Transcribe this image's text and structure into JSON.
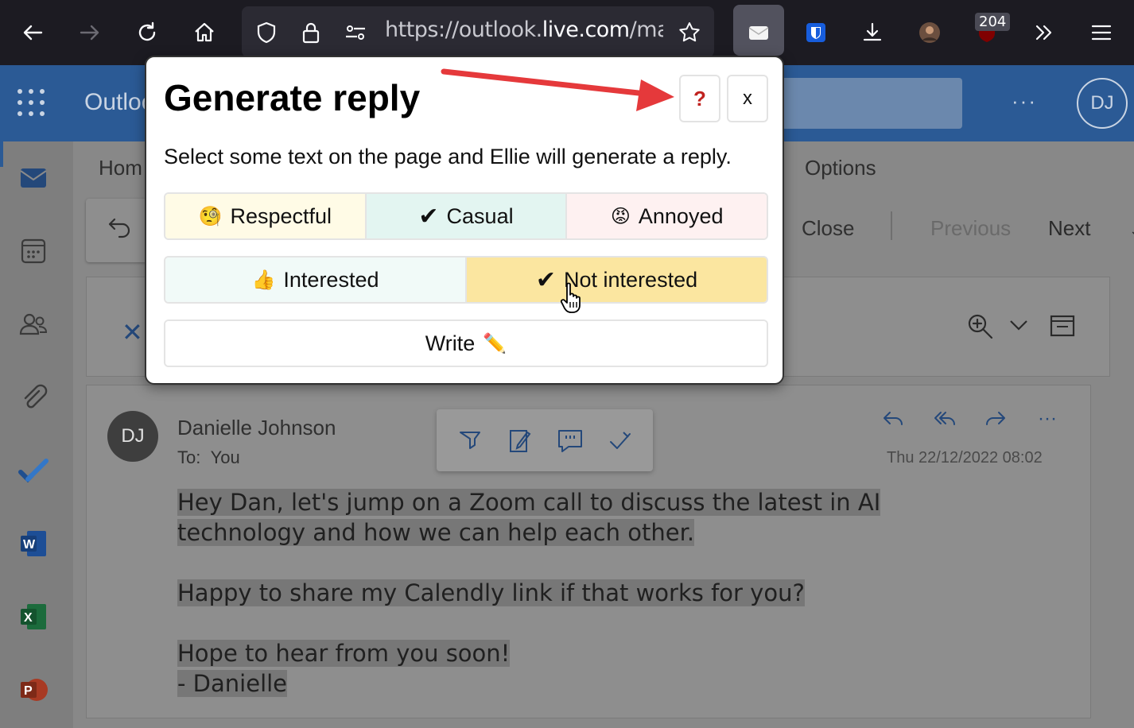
{
  "browser": {
    "url_prefix": "https://outlook.",
    "url_domain": "live.com",
    "url_suffix": "/ma",
    "badge_count": "204"
  },
  "outlook": {
    "brand": "Outlook",
    "avatar_initials": "DJ",
    "tabs": {
      "home": "Hom",
      "options": "Options"
    },
    "ribbon": {
      "close": "Close",
      "previous": "Previous",
      "next": "Next"
    },
    "message": {
      "sender": "Danielle Johnson",
      "to_label": "To:",
      "to_value": "You",
      "date": "Thu 22/12/2022 08:02",
      "avatar_initials": "DJ",
      "body": {
        "line1": "Hey Dan, let's jump on a Zoom call to discuss the latest in AI",
        "line2": "technology and how we can help each other.",
        "line3": "Happy to share my Calendly link if that works for you?",
        "line4": "Hope to hear from you soon!",
        "line5": "- Danielle"
      }
    }
  },
  "popup": {
    "title": "Generate reply",
    "help_label": "?",
    "close_label": "x",
    "description": "Select some text on the page and Ellie will generate a reply.",
    "tone_options": [
      {
        "emoji": "🧐",
        "label": "Respectful"
      },
      {
        "emoji": "✔",
        "label": "Casual"
      },
      {
        "emoji": "😡",
        "label": "Annoyed"
      }
    ],
    "interest_options": [
      {
        "emoji": "👍",
        "label": "Interested"
      },
      {
        "emoji": "✔",
        "label": "Not interested"
      }
    ],
    "write_label": "Write",
    "write_emoji": "✏️"
  },
  "colors": {
    "outlook_blue": "#2b5a95",
    "arrow_red": "#e5393b",
    "help_red": "#c0221f",
    "selected_yellow": "#fbe6a0"
  }
}
